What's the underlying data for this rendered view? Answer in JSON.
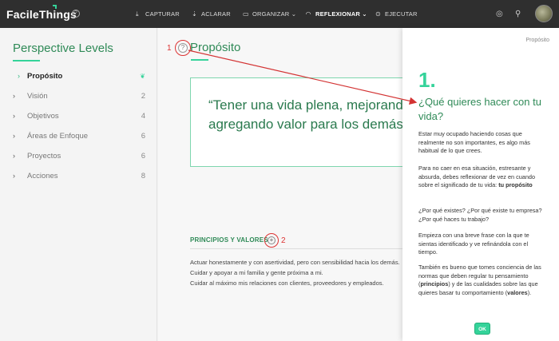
{
  "app": {
    "logo": "FacileThings"
  },
  "nav": [
    {
      "label": "CAPTURAR",
      "icon": "⤓",
      "name": "nav-capturar"
    },
    {
      "label": "ACLARAR",
      "icon": "⇣",
      "name": "nav-aclarar"
    },
    {
      "label": "ORGANIZAR",
      "icon": "▭",
      "name": "nav-organizar",
      "caret": "⌄"
    },
    {
      "label": "REFLEXIONAR",
      "icon": "◠",
      "name": "nav-reflexionar",
      "caret": "⌄"
    },
    {
      "label": "EJECUTAR",
      "icon": "⊙",
      "name": "nav-ejecutar"
    }
  ],
  "sidebar": {
    "title": "Perspective Levels",
    "items": [
      {
        "label": "Propósito",
        "count": ""
      },
      {
        "label": "Visión",
        "count": "2"
      },
      {
        "label": "Objetivos",
        "count": "4"
      },
      {
        "label": "Áreas de Enfoque",
        "count": "6"
      },
      {
        "label": "Proyectos",
        "count": "6"
      },
      {
        "label": "Acciones",
        "count": "8"
      }
    ]
  },
  "main": {
    "title": "Propósito",
    "annotation_1": "1",
    "annotation_2": "2",
    "quote_line1": "“Tener una vida plena, mejorando",
    "quote_line2": "agregando valor para los demás”",
    "section_title": "PRINCIPIOS Y VALORES",
    "values": [
      "Actuar honestamente y con asertividad, pero con sensibilidad hacia los demás.",
      "Cuidar y apoyar a mi familia y gente próxima a mi.",
      "Cuidar al máximo mis relaciones con clientes, proveedores y empleados."
    ]
  },
  "panel": {
    "top_label": "Propósito",
    "step": "1.",
    "question": "¿Qué quieres hacer con tu vida?",
    "p1": "Estar muy ocupado haciendo cosas que realmente no son importantes, es algo más habitual de lo que crees.",
    "p2_a": "Para no caer en esa situación, estresante y absurda, debes reflexionar de vez en cuando sobre el significado de tu vida: ",
    "p2_b": "tu propósito",
    "p3": "¿Por qué existes? ¿Por qué existe tu empresa? ¿Por qué haces tu trabajo?",
    "p4": "Empieza con una breve frase con la que te sientas identificado y ve refinándola con el tiempo.",
    "p5_a": "También es bueno que tomes conciencia de las normas que deben regular tu pensamiento (",
    "p5_b": "principios",
    "p5_c": ") y de las cualidades sobre las que quieres basar tu comportamiento (",
    "p5_d": "valores",
    "p5_e": ").",
    "ok": "OK"
  },
  "colors": {
    "accent": "#35d39a",
    "title_green": "#2f8a57",
    "annotation_red": "#d33333",
    "topbar": "#2f2f2f"
  }
}
